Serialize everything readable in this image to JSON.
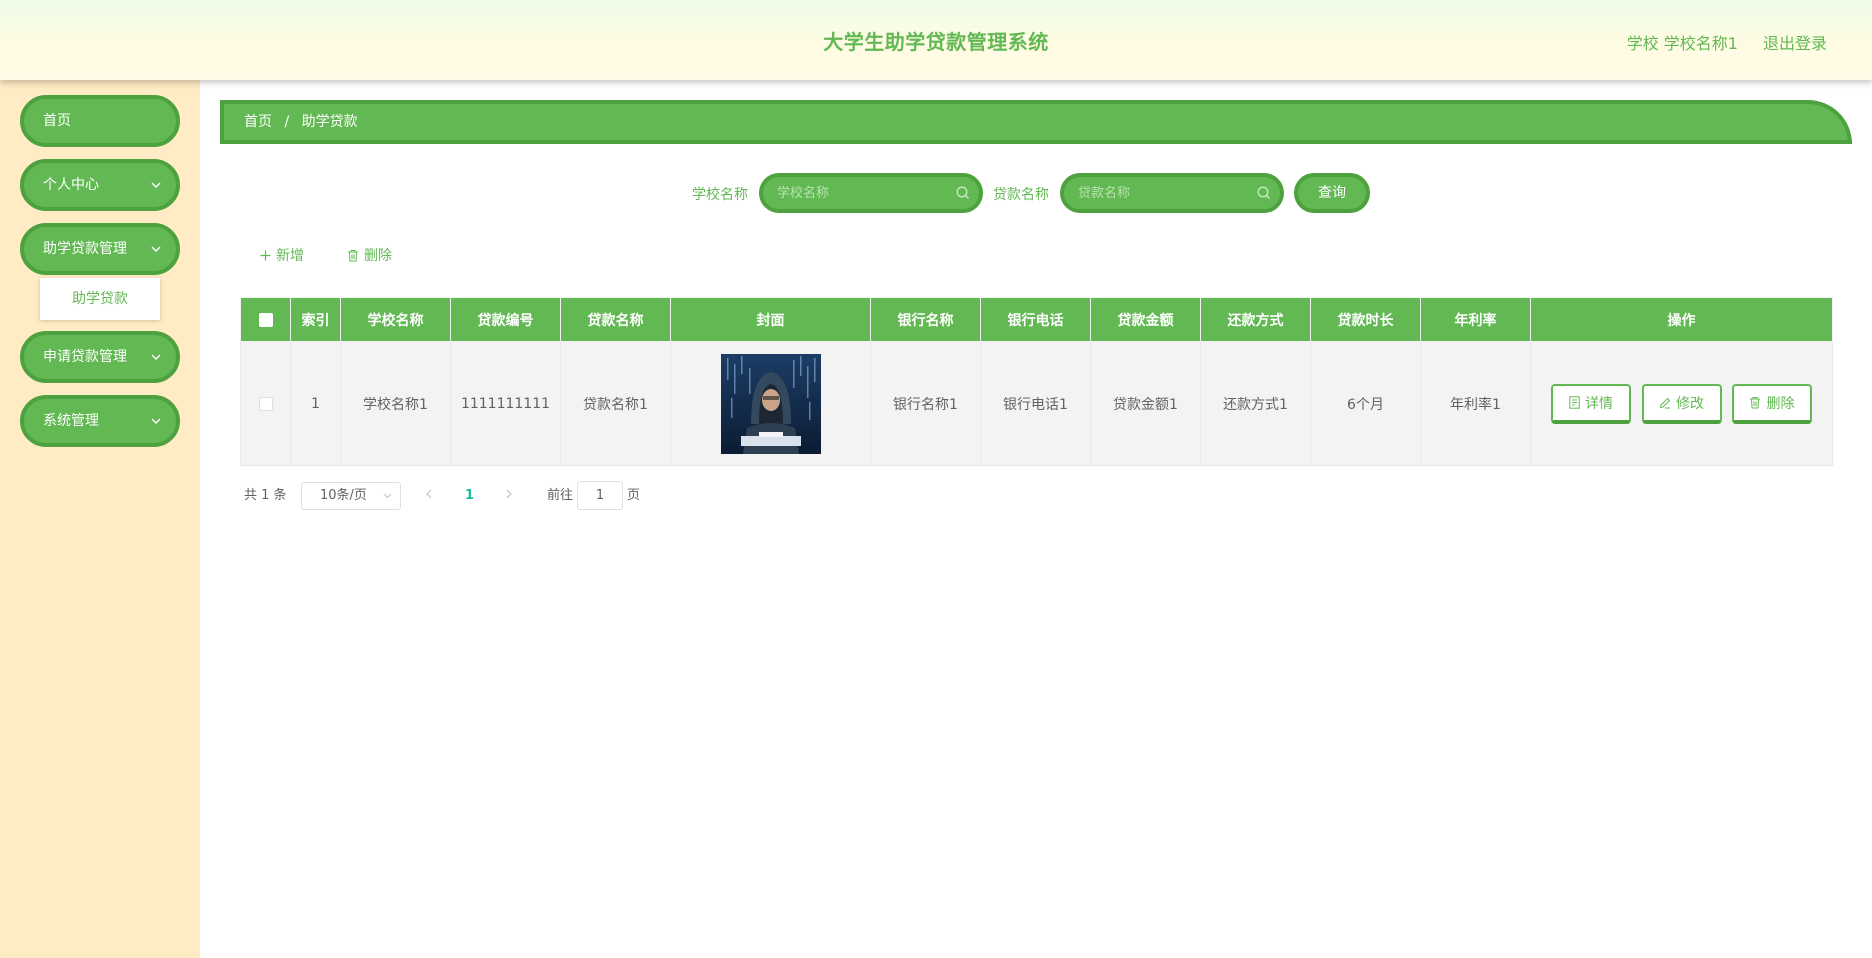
{
  "header": {
    "title": "大学生助学贷款管理系统",
    "user_label": "学校 学校名称1",
    "logout_label": "退出登录"
  },
  "sidebar": {
    "items": [
      {
        "label": "首页"
      },
      {
        "label": "个人中心"
      },
      {
        "label": "助学贷款管理"
      },
      {
        "label": "申请贷款管理"
      },
      {
        "label": "系统管理"
      }
    ],
    "submenu": {
      "label": "助学贷款"
    }
  },
  "breadcrumb": {
    "home": "首页",
    "separator": "/",
    "current": "助学贷款"
  },
  "search": {
    "school_label": "学校名称",
    "school_placeholder": "学校名称",
    "loan_label": "贷款名称",
    "loan_placeholder": "贷款名称",
    "query_label": "查询"
  },
  "actions": {
    "add_label": "新增",
    "delete_label": "删除"
  },
  "table": {
    "headers": [
      "索引",
      "学校名称",
      "贷款编号",
      "贷款名称",
      "封面",
      "银行名称",
      "银行电话",
      "贷款金额",
      "还款方式",
      "贷款时长",
      "年利率",
      "操作"
    ],
    "rows": [
      {
        "index": "1",
        "school": "学校名称1",
        "loan_no": "1111111111",
        "loan_name": "贷款名称1",
        "bank": "银行名称1",
        "phone": "银行电话1",
        "amount": "贷款金额1",
        "repay": "还款方式1",
        "duration": "6个月",
        "rate": "年利率1",
        "detail_label": "详情",
        "edit_label": "修改",
        "delete_label": "删除"
      }
    ]
  },
  "pagination": {
    "total": "共 1 条",
    "page_size": "10条/页",
    "current_page": "1",
    "goto_label": "前往",
    "goto_value": "1",
    "page_suffix": "页"
  },
  "colors": {
    "accent": "#62b953",
    "accent_dark": "#4da23f",
    "sidebar_bg": "#ffecc4",
    "row_bg": "#f3f3f3",
    "page_active": "#1abc9c"
  },
  "icons": {
    "chevron": "chevron-down-icon",
    "search": "search-icon",
    "add": "plus-icon",
    "delete": "trash-icon",
    "detail": "document-icon",
    "edit": "edit-icon"
  }
}
